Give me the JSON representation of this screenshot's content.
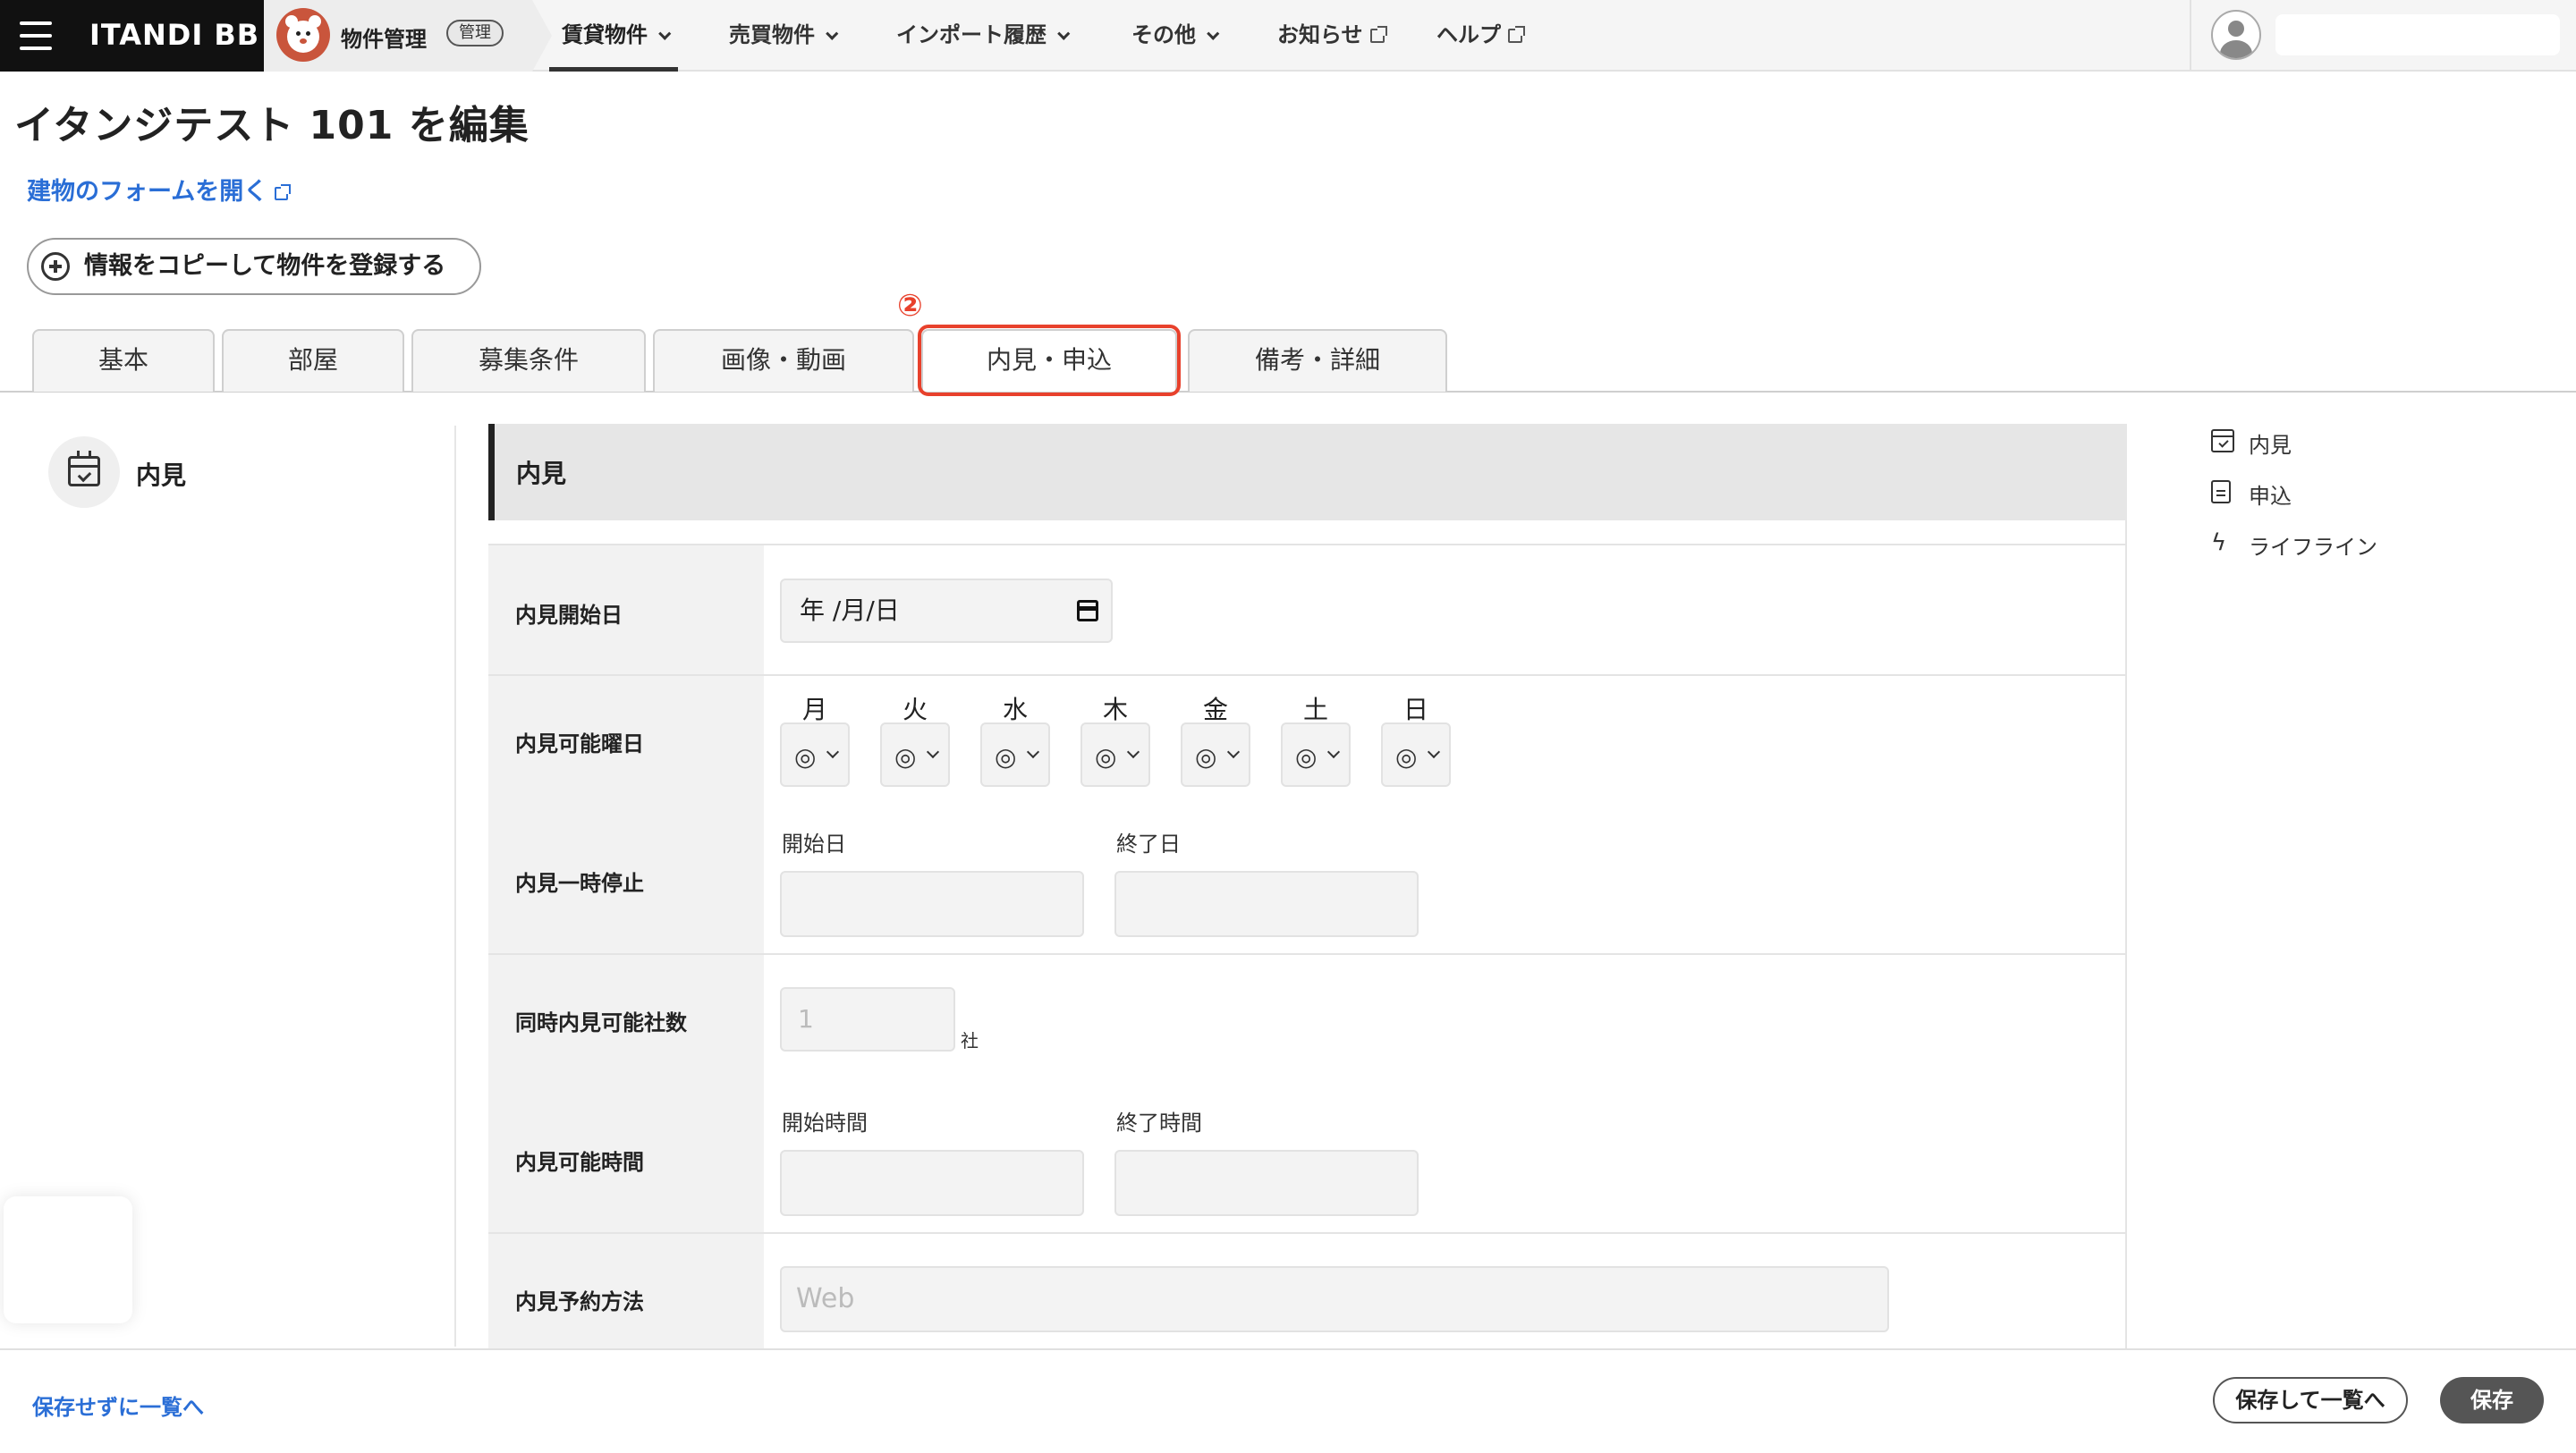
{
  "topbar": {
    "brand": "ITANDI BB",
    "app_label": "物件管理",
    "app_badge": "管理",
    "nav": [
      {
        "label": "賃貸物件"
      },
      {
        "label": "売買物件"
      },
      {
        "label": "インポート履歴"
      },
      {
        "label": "その他"
      },
      {
        "label": "お知らせ"
      },
      {
        "label": "ヘルプ"
      }
    ]
  },
  "page": {
    "title": "イタンジテスト 101 を編集",
    "open_building_link": "建物のフォームを開く",
    "copy_button": "情報をコピーして物件を登録する"
  },
  "tabs": [
    {
      "label": "基本"
    },
    {
      "label": "部屋"
    },
    {
      "label": "募集条件"
    },
    {
      "label": "画像・動画"
    },
    {
      "label": "内見・申込"
    },
    {
      "label": "備考・詳細"
    }
  ],
  "annotation": {
    "marker": "②"
  },
  "section_nav": {
    "label": "内見"
  },
  "form": {
    "header": "内見",
    "start_date": {
      "label": "内見開始日",
      "value": "年 /月/日"
    },
    "weekdays": {
      "label": "内見可能曜日",
      "days": [
        {
          "day": "月",
          "mark": "◎"
        },
        {
          "day": "火",
          "mark": "◎"
        },
        {
          "day": "水",
          "mark": "◎"
        },
        {
          "day": "木",
          "mark": "◎"
        },
        {
          "day": "金",
          "mark": "◎"
        },
        {
          "day": "土",
          "mark": "◎"
        },
        {
          "day": "日",
          "mark": "◎"
        }
      ]
    },
    "suspension": {
      "label": "内見一時停止",
      "start_label": "開始日",
      "end_label": "終了日"
    },
    "concurrent": {
      "label": "同時内見可能社数",
      "placeholder": "1",
      "unit": "社"
    },
    "hours": {
      "label": "内見可能時間",
      "start_label": "開始時間",
      "end_label": "終了時間"
    },
    "method": {
      "label": "内見予約方法",
      "placeholder": "Web"
    }
  },
  "toc": [
    {
      "label": "内見",
      "icon": "calendar-check-icon"
    },
    {
      "label": "申込",
      "icon": "document-icon"
    },
    {
      "label": "ライフライン",
      "icon": "lightning-icon"
    }
  ],
  "footer": {
    "back_link": "保存せずに一覧へ",
    "save_and_list": "保存して一覧へ",
    "save": "保存"
  },
  "colors": {
    "accent_link": "#2a6ed6",
    "highlight": "#e8412c",
    "dark": "#111111"
  }
}
